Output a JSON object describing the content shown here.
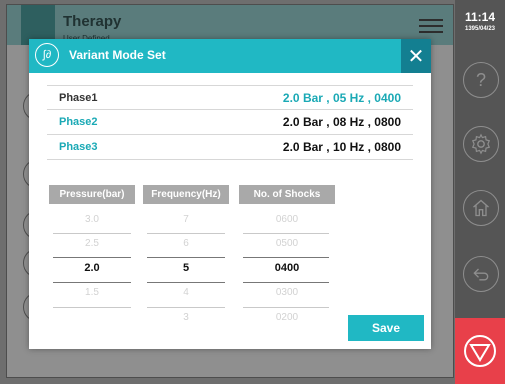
{
  "background": {
    "title": "Therapy",
    "subtitle": "User Defined"
  },
  "sidebar": {
    "time": "11:14",
    "date": "1395/04/23",
    "help_icon": "question-icon",
    "settings_icon": "gear-icon",
    "home_icon": "home-icon",
    "back_icon": "back-arrow-icon",
    "stop_icon": "stop-triangle-icon"
  },
  "dialog": {
    "title": "Variant Mode Set",
    "close_label": "✕",
    "accent_color": "#20b8c4",
    "phases": [
      {
        "name": "Phase1",
        "value": "2.0 Bar , 05 Hz , 0400",
        "selected": true
      },
      {
        "name": "Phase2",
        "value": "2.0 Bar , 08 Hz , 0800",
        "selected": false
      },
      {
        "name": "Phase3",
        "value": "2.0 Bar , 10 Hz , 0800",
        "selected": false
      }
    ],
    "columns": {
      "pressure": {
        "header": "Pressure(bar)",
        "items": [
          "3.0",
          "2.5",
          "2.0",
          "1.5",
          ""
        ],
        "selected": "2.0"
      },
      "frequency": {
        "header": "Frequency(Hz)",
        "items": [
          "7",
          "6",
          "5",
          "4",
          "3"
        ],
        "selected": "5"
      },
      "shocks": {
        "header": "No. of Shocks",
        "items": [
          "0600",
          "0500",
          "0400",
          "0300",
          "0200"
        ],
        "selected": "0400"
      }
    },
    "save_label": "Save"
  }
}
